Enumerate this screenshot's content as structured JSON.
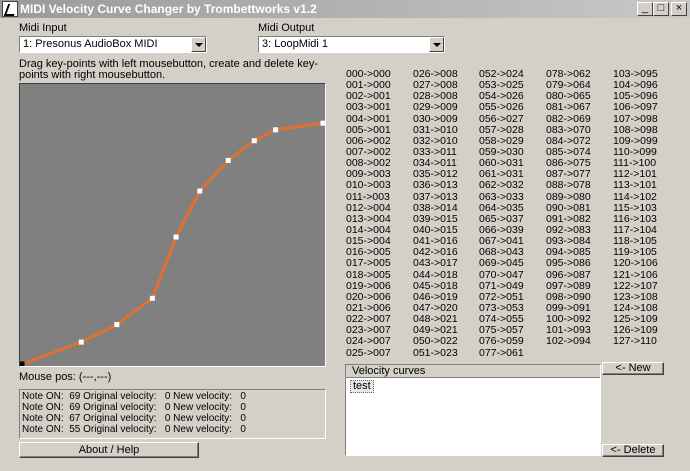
{
  "titlebar": {
    "title": "MIDI Velocity Curve Changer by Trombettworks v1.2",
    "min": "_",
    "max": "□",
    "close": "×"
  },
  "midi_input": {
    "label": "Midi Input",
    "value": "1: Presonus AudioBox MIDI"
  },
  "midi_output": {
    "label": "Midi Output",
    "value": "3: LoopMidi 1"
  },
  "instructions": "Drag key-points with left mousebutton, create and delete key-points with right mousebutton.",
  "mouse_pos": "Mouse pos: (---,---)",
  "log": [
    "Note ON:  69 Original velocity:   0 New velocity:   0",
    "Note ON:  69 Original velocity:   0 New velocity:   0",
    "Note ON:  67 Original velocity:   0 New velocity:   0",
    "Note ON:  55 Original velocity:   0 New velocity:   0"
  ],
  "buttons": {
    "about": "About / Help",
    "new": "<- New",
    "delete": "<- Delete"
  },
  "velocity_curves": {
    "header": "Velocity curves",
    "items": [
      "test"
    ]
  },
  "curve": {
    "line_color": "#e07030",
    "keypoints": [
      [
        0,
        0
      ],
      [
        25,
        10
      ],
      [
        40,
        18
      ],
      [
        55,
        30
      ],
      [
        65,
        58
      ],
      [
        75,
        79
      ],
      [
        87,
        93
      ],
      [
        98,
        102
      ],
      [
        107,
        107
      ],
      [
        127,
        110
      ]
    ]
  },
  "mapping_columns": [
    [
      "000->000",
      "001->000",
      "002->001",
      "003->001",
      "004->001",
      "005->001",
      "006->002",
      "007->002",
      "008->002",
      "009->003",
      "010->003",
      "011->003",
      "012->004",
      "013->004",
      "014->004",
      "015->004",
      "016->005",
      "017->005",
      "018->005",
      "019->006",
      "020->006",
      "021->006",
      "022->007",
      "023->007",
      "024->007",
      "025->007"
    ],
    [
      "026->008",
      "027->008",
      "028->008",
      "029->009",
      "030->009",
      "031->010",
      "032->010",
      "033->011",
      "034->011",
      "035->012",
      "036->013",
      "037->013",
      "038->014",
      "039->015",
      "040->015",
      "041->016",
      "042->016",
      "043->017",
      "044->018",
      "045->018",
      "046->019",
      "047->020",
      "048->021",
      "049->021",
      "050->022",
      "051->023"
    ],
    [
      "052->024",
      "053->025",
      "054->026",
      "055->026",
      "056->027",
      "057->028",
      "058->029",
      "059->030",
      "060->031",
      "061->031",
      "062->032",
      "063->033",
      "064->035",
      "065->037",
      "066->039",
      "067->041",
      "068->043",
      "069->045",
      "070->047",
      "071->049",
      "072->051",
      "073->053",
      "074->055",
      "075->057",
      "076->059",
      "077->061"
    ],
    [
      "078->062",
      "079->064",
      "080->065",
      "081->067",
      "082->069",
      "083->070",
      "084->072",
      "085->074",
      "086->075",
      "087->077",
      "088->078",
      "089->080",
      "090->081",
      "091->082",
      "092->083",
      "093->084",
      "094->085",
      "095->086",
      "096->087",
      "097->089",
      "098->090",
      "099->091",
      "100->092",
      "101->093",
      "102->094"
    ],
    [
      "103->095",
      "104->096",
      "105->096",
      "106->097",
      "107->098",
      "108->098",
      "109->099",
      "110->099",
      "111->100",
      "112->101",
      "113->101",
      "114->102",
      "115->103",
      "116->103",
      "117->104",
      "118->105",
      "119->105",
      "120->106",
      "121->106",
      "122->107",
      "123->108",
      "124->108",
      "125->109",
      "126->109",
      "127->110"
    ]
  ]
}
